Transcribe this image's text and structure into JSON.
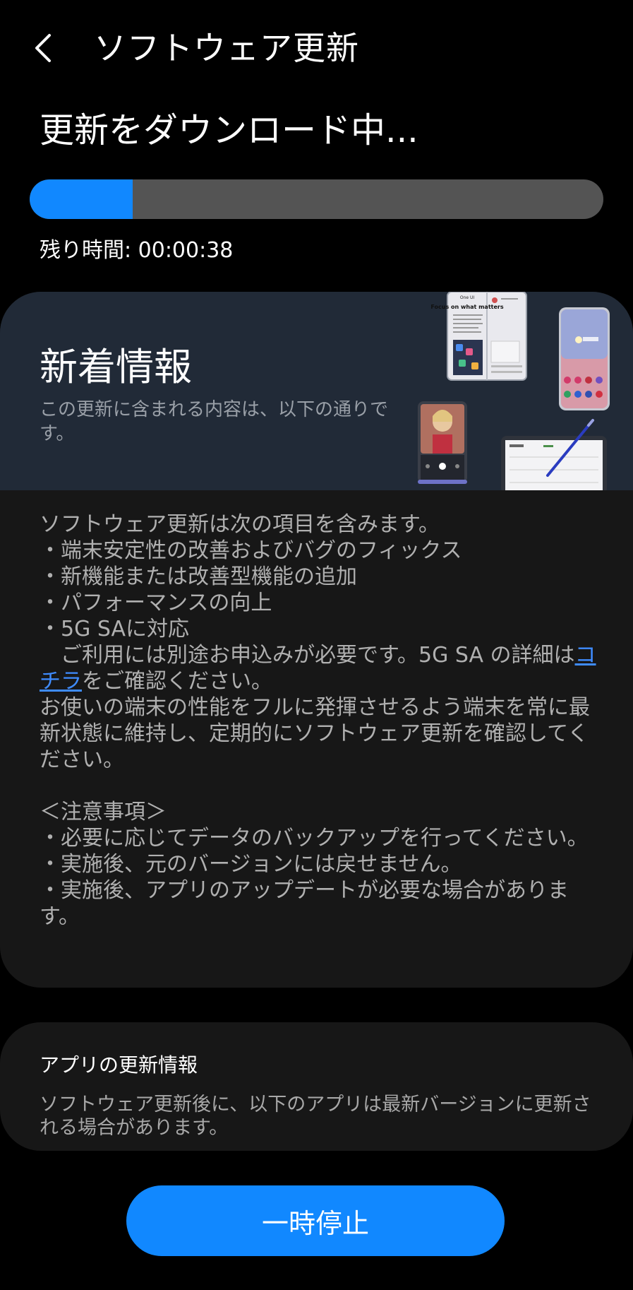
{
  "header": {
    "back_icon": "chevron-left-icon",
    "title": "ソフトウェア更新"
  },
  "status": {
    "title": "更新をダウンロード中...",
    "progress": 0.18,
    "remaining_label": "残り時間: 00:00:38"
  },
  "whats_new": {
    "title": "新着情報",
    "subtitle": "この更新に含まれる内容は、以下の通りです。",
    "illustration": "device-collage",
    "illustration_text": {
      "promo_small": "One UI",
      "promo_headline": "Focus on what matters"
    }
  },
  "notes": {
    "intro": "ソフトウェア更新は次の項目を含みます。",
    "bullets": [
      "・端末安定性の改善およびバグのフィックス",
      "・新機能または改善型機能の追加",
      "・パフォーマンスの向上",
      "・5G SAに対応"
    ],
    "sa_note_before": "ご利用には別途お申込みが必要です。5G SA の詳細は",
    "sa_note_link": "コチラ",
    "sa_note_after": "をご確認ください。",
    "recommend": "お使いの端末の性能をフルに発揮させるよう端末を常に最新状態に維持し、定期的にソフトウェア更新を確認してください。",
    "caution_title": "＜注意事項＞",
    "cautions": [
      "・必要に応じてデータのバックアップを行ってください。",
      "・実施後、元のバージョンには戻せません。",
      "・実施後、アプリのアップデートが必要な場合があります。"
    ]
  },
  "app_updates": {
    "title": "アプリの更新情報",
    "description": "ソフトウェア更新後に、以下のアプリは最新バージョンに更新される場合があります。"
  },
  "actions": {
    "pause_label": "一時停止"
  },
  "colors": {
    "accent": "#1188ff",
    "background": "#000000",
    "card": "#171717",
    "banner": "#212a37",
    "link": "#3f8cff"
  }
}
